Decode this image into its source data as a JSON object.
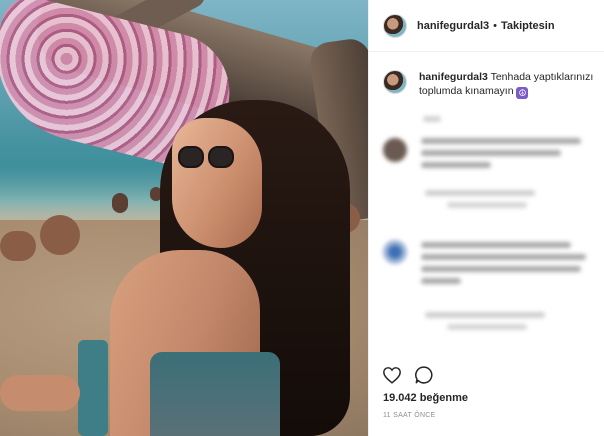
{
  "post": {
    "author": "hanifegurdal3",
    "separator": "•",
    "follow_label": "Takiptesin",
    "caption_author": "hanifegurdal3",
    "caption_text": "Tenhada yaptıklarınızı toplumda kınamayın",
    "caption_emoji": "☮",
    "likes_text": "19.042 beğenme",
    "timestamp": "11 SAAT ÖNCE"
  },
  "icons": {
    "like": "heart-outline-icon",
    "comment": "comment-bubble-icon"
  },
  "colors": {
    "text": "#262626",
    "muted": "#8e8e8e",
    "border": "#efefef"
  }
}
